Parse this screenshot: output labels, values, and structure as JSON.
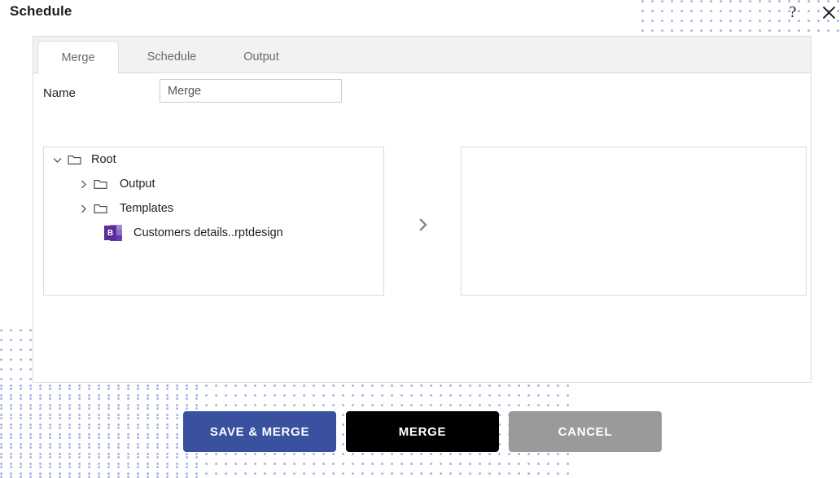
{
  "header": {
    "title": "Schedule",
    "help_icon": "question-mark-icon",
    "help_glyph": "?",
    "close_icon": "close-icon"
  },
  "tabs": [
    {
      "label": "Merge",
      "active": true
    },
    {
      "label": "Schedule",
      "active": false
    },
    {
      "label": "Output",
      "active": false
    }
  ],
  "form": {
    "name_label": "Name",
    "name_value": "Merge",
    "name_placeholder": "Merge"
  },
  "tree": {
    "items": [
      {
        "label": "Root",
        "type": "folder",
        "expanded": true,
        "level": 0,
        "chevron": "chevron-down-icon"
      },
      {
        "label": "Output",
        "type": "folder",
        "expanded": false,
        "level": 1,
        "chevron": "chevron-right-icon"
      },
      {
        "label": "Templates",
        "type": "folder",
        "expanded": false,
        "level": 1,
        "chevron": "chevron-right-icon"
      },
      {
        "label": "Customers details..rptdesign",
        "type": "report",
        "level": 1,
        "badge": "B"
      }
    ]
  },
  "transfer": {
    "icon": "chevron-right-icon"
  },
  "target_panel": {
    "items": []
  },
  "footer": {
    "save_merge_label": "SAVE & MERGE",
    "merge_label": "MERGE",
    "cancel_label": "CANCEL"
  },
  "colors": {
    "primary_blue": "#3a51a0",
    "merge_black": "#000000",
    "cancel_gray": "#9a9a9a",
    "dot_pattern": "#a9b4e6",
    "tab_bar_bg": "#f2f2f2",
    "border": "#dcdcdc",
    "report_icon_purple": "#5b2d9b"
  }
}
